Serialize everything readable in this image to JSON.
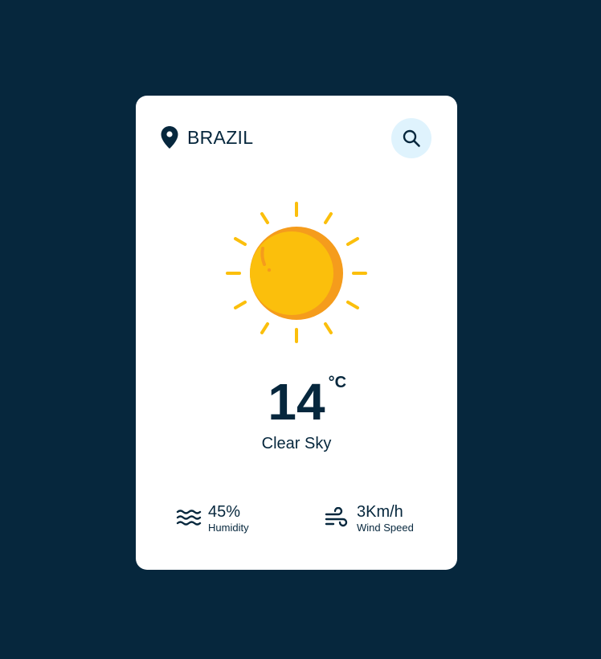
{
  "location": {
    "icon": "map-pin-icon",
    "city": "BRAZIL"
  },
  "search": {
    "icon": "search-icon"
  },
  "weather": {
    "icon": "sun-icon",
    "temperature": "14",
    "unit": "°C",
    "description": "Clear Sky"
  },
  "details": {
    "humidity": {
      "icon": "waves-icon",
      "value": "45%",
      "label": "Humidity"
    },
    "wind": {
      "icon": "wind-icon",
      "value": "3Km/h",
      "label": "Wind Speed"
    }
  },
  "colors": {
    "background": "#06273d",
    "card": "#ffffff",
    "search_button": "#dff3fd",
    "sun": "#fbbf0c",
    "sun_shade": "#f59c1c"
  }
}
